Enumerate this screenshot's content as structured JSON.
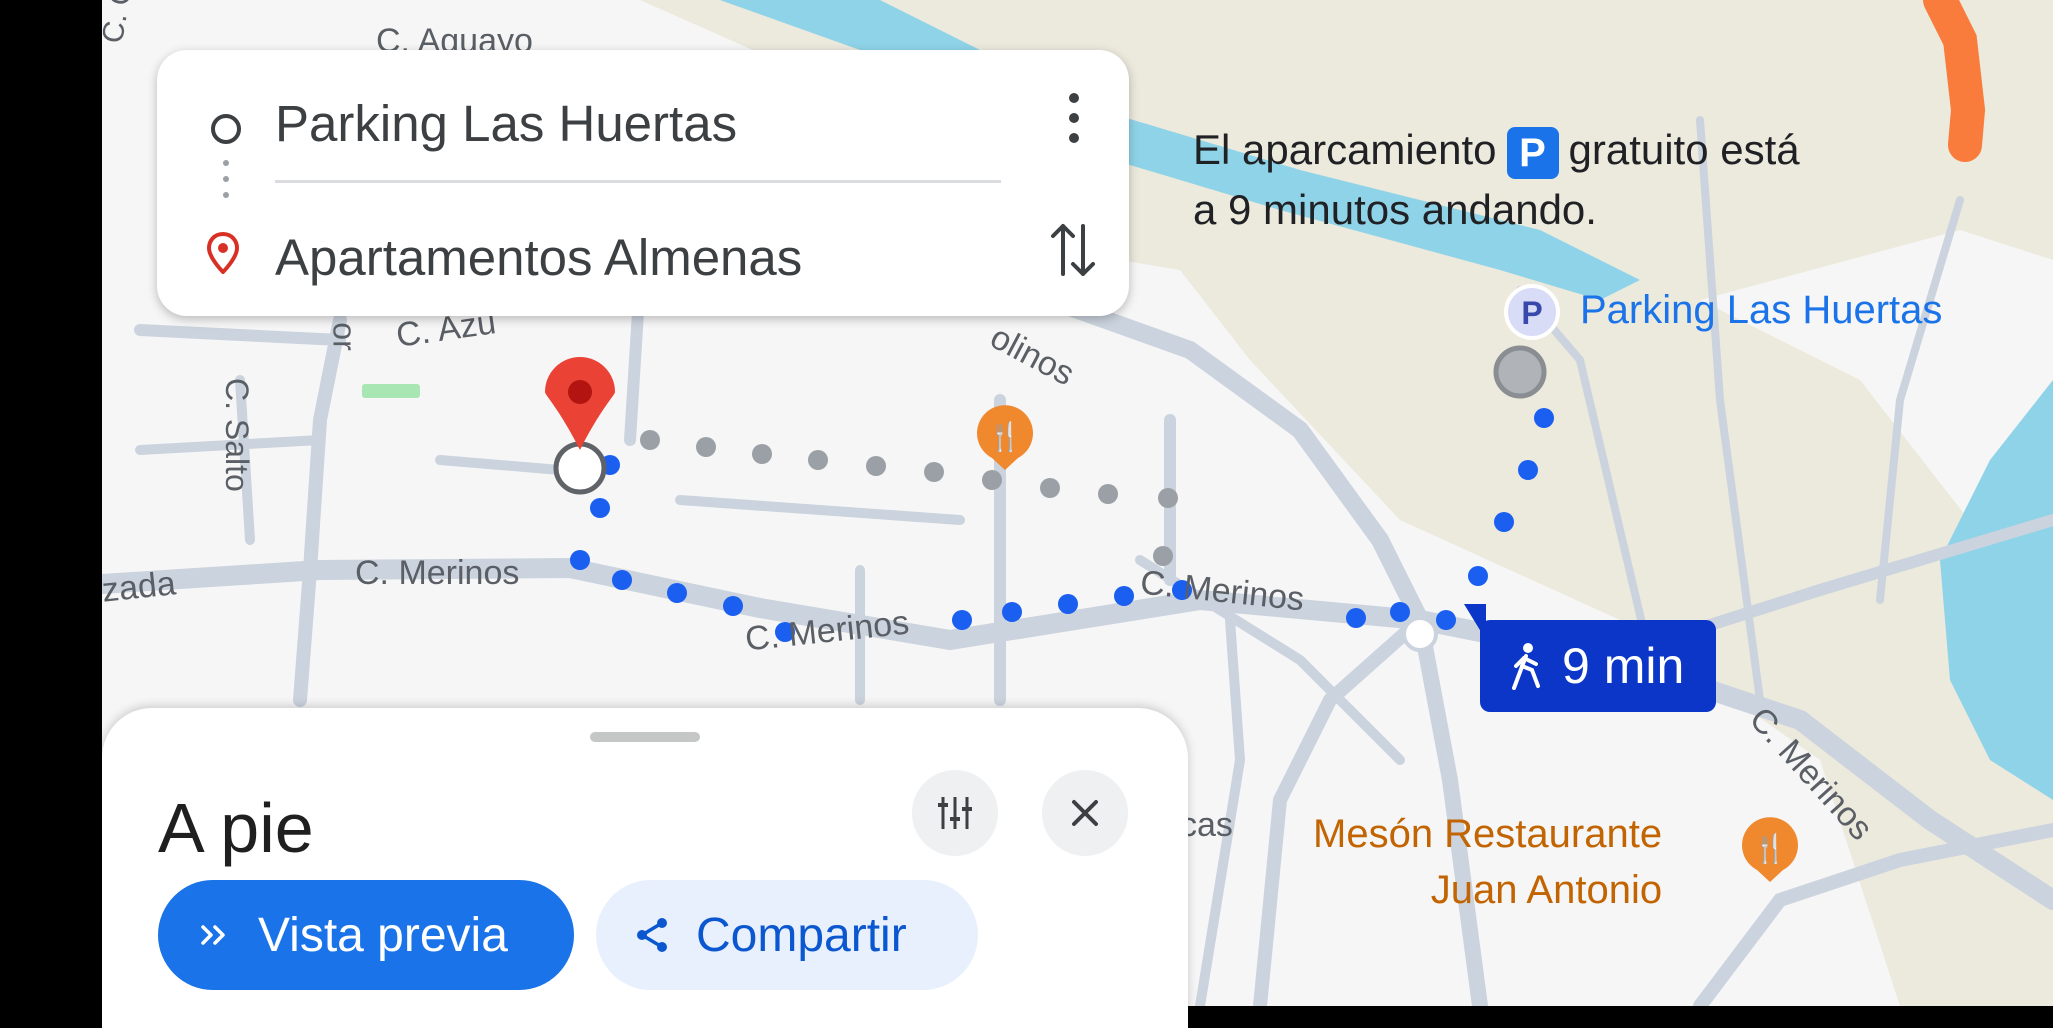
{
  "directions": {
    "origin": "Parking Las Huertas",
    "destination": "Apartamentos Almenas"
  },
  "map": {
    "streets": {
      "aguayo": "C. Aguayo",
      "caus": "C. Caus",
      "azu": "C. Azu",
      "salto": "C. Salto",
      "merinos_1": "C. Merinos",
      "merinos_2": "C. Merinos",
      "merinos_3": "C. Merinos",
      "merinos_4": "C. Merinos",
      "molinos": "olinos",
      "zada": "zada",
      "or": "or",
      "cas": "cas"
    },
    "callout": {
      "before": "El aparcamiento",
      "parking_symbol": "P",
      "after": "gratuito está",
      "line2": "a 9 minutos andando."
    },
    "parking_poi": {
      "icon": "P",
      "label": "Parking Las Huertas"
    },
    "restaurant_poi": {
      "line1": "Mesón Restaurante",
      "line2": "Juan Antonio"
    },
    "walk_time": "9 min",
    "colors": {
      "route_blue": "#1a5ff0",
      "walk_chip": "#0b36c8",
      "restaurant_orange": "#f0892e",
      "pin_red": "#ea4335",
      "water": "#8fd3e8",
      "park": "#ece9dd",
      "road": "#c7d0dc"
    }
  },
  "sheet": {
    "mode_title": "A pie",
    "preview_label": "Vista previa",
    "share_label": "Compartir"
  }
}
